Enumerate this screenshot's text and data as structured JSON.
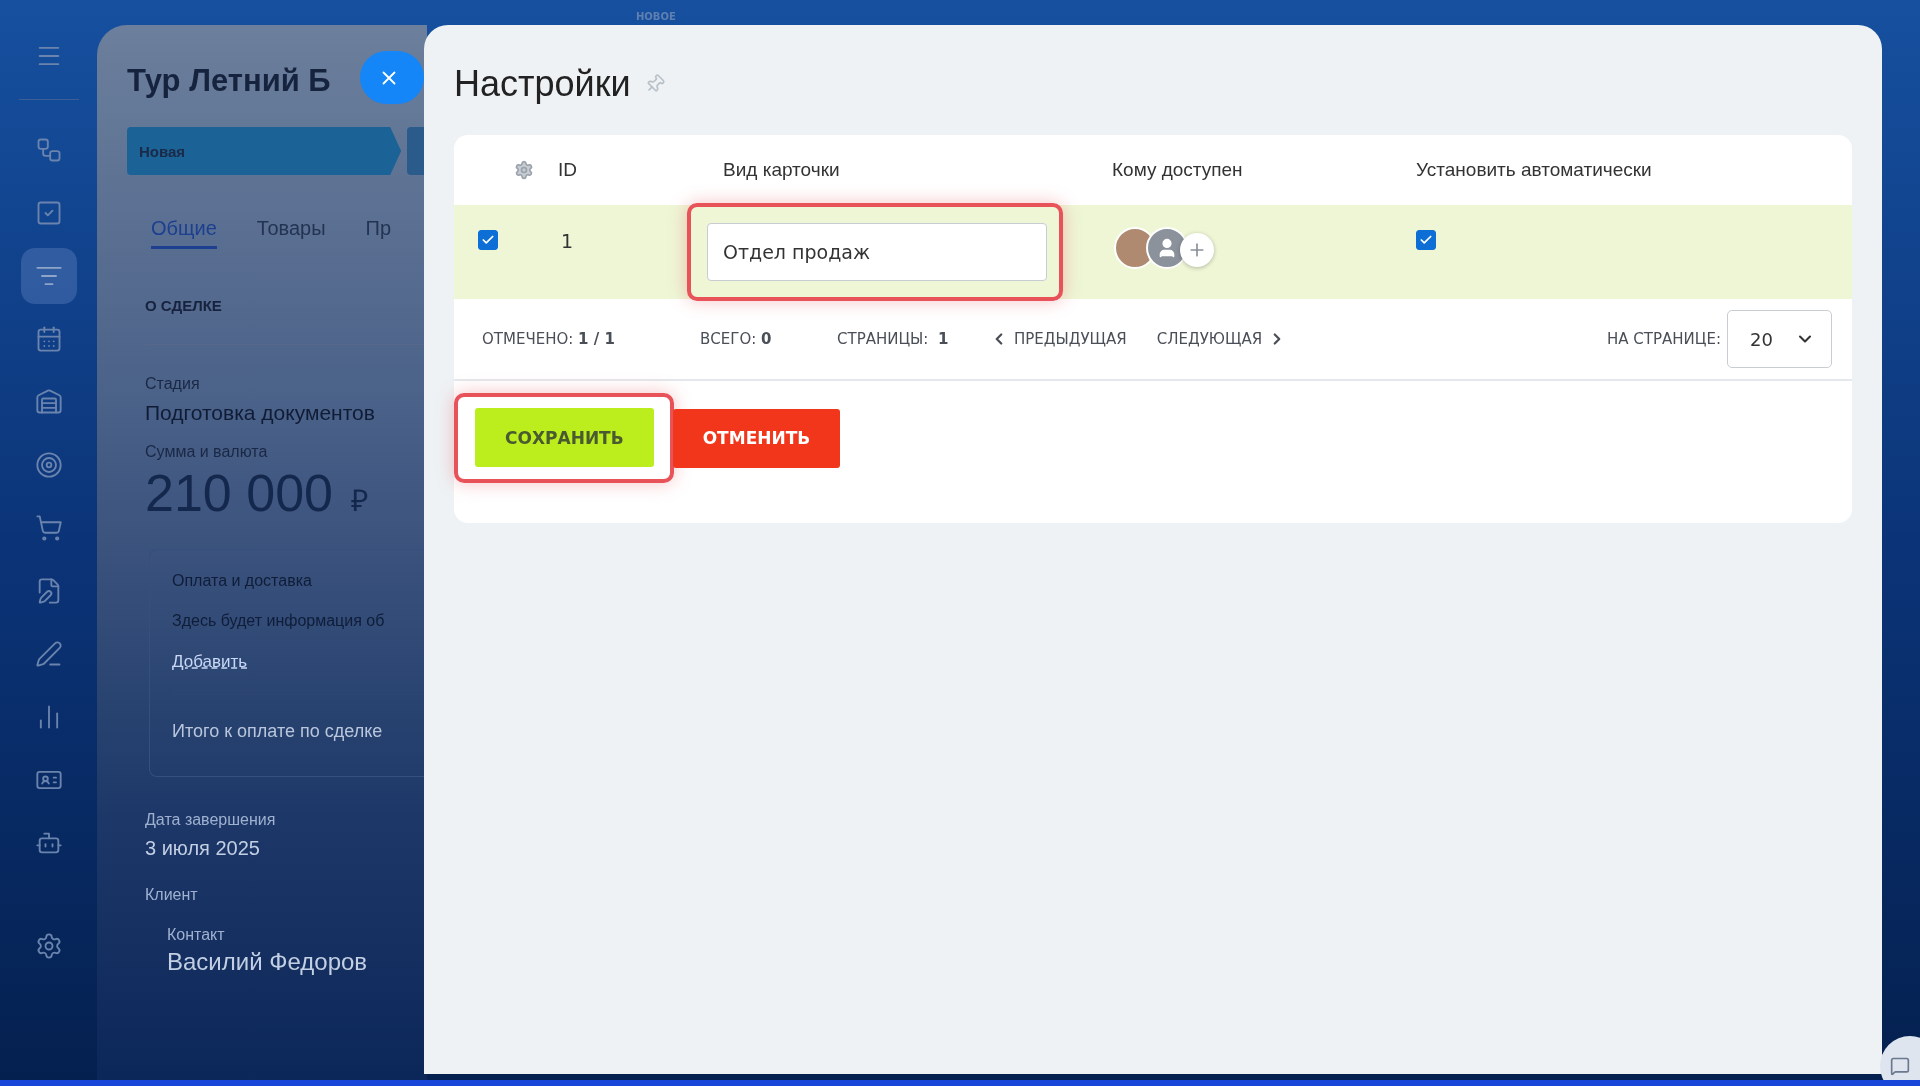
{
  "top_bar": {
    "label": "НОВОЕ"
  },
  "sidebar": {
    "items": [
      {
        "selected": false
      },
      {
        "selected": false
      },
      {
        "selected": false
      },
      {
        "selected": true
      },
      {
        "selected": false
      },
      {
        "selected": false
      },
      {
        "selected": false
      },
      {
        "selected": false
      },
      {
        "selected": false
      },
      {
        "selected": false
      },
      {
        "selected": false
      },
      {
        "selected": false
      },
      {
        "selected": false
      },
      {
        "selected": false
      }
    ]
  },
  "deal": {
    "title": "Тур Летний Б",
    "stages": [
      {
        "label": "Новая",
        "selected": true
      }
    ],
    "tabs": [
      {
        "label": "Общие",
        "selected": true
      },
      {
        "label": "Товары",
        "selected": false
      },
      {
        "label": "Пр",
        "selected": false
      }
    ],
    "section_title": "О СДЕЛКЕ",
    "stage_label": "Стадия",
    "stage_value": "Подготовка документов",
    "amount_label": "Сумма и валюта",
    "amount_value": "210 000",
    "currency": "₽",
    "payment": {
      "title": "Оплата и доставка",
      "text": "Здесь будет информация об",
      "link": "Добавить",
      "total": "Итого к оплате по сделке"
    },
    "date_label": "Дата завершения",
    "date_value": "3 июля 2025",
    "client_label": "Клиент",
    "contact_label": "Контакт",
    "contact_name": "Василий Федоров"
  },
  "settings": {
    "title": "Настройки",
    "columns": [
      "ID",
      "Вид карточки",
      "Кому доступен",
      "Установить автоматически"
    ],
    "rows": [
      {
        "selected": true,
        "checked": true,
        "id": "1",
        "card_type": "Отдел продаж",
        "card_type_highlighted": true,
        "auto": true
      }
    ],
    "footer": {
      "checked_label": "ОТМЕЧЕНО:",
      "checked_value": "1 / 1",
      "total_label": "ВСЕГО:",
      "total_value": "0",
      "pages_label": "СТРАНИЦЫ:",
      "pages_value": "1",
      "prev": "ПРЕДЫДУЩАЯ",
      "next": "СЛЕДУЮЩАЯ",
      "per_page_label": "НА СТРАНИЦЕ:",
      "per_page_value": "20"
    },
    "buttons": [
      {
        "kind": "save",
        "label": "СОХРАНИТЬ",
        "highlighted": true
      },
      {
        "kind": "cancel",
        "label": "ОТМЕНИТЬ",
        "highlighted": false
      }
    ]
  }
}
